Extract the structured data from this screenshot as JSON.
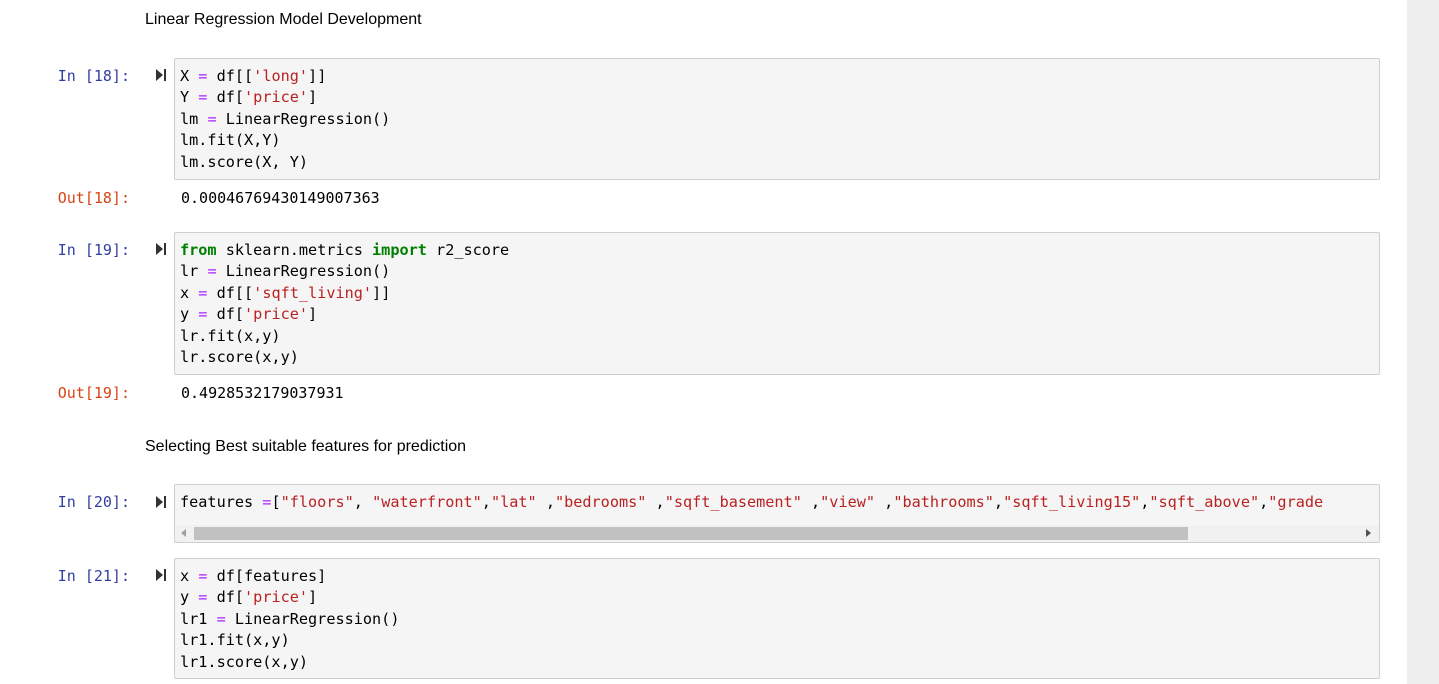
{
  "headings": {
    "model_dev": "Linear Regression Model Development",
    "feature_select": "Selecting Best suitable features for prediction"
  },
  "cells": {
    "c18": {
      "in_prompt": "In [18]:",
      "out_prompt": "Out[18]:",
      "output": "0.00046769430149007363"
    },
    "c19": {
      "in_prompt": "In [19]:",
      "out_prompt": "Out[19]:",
      "output": "0.4928532179037931"
    },
    "c20": {
      "in_prompt": "In [20]:"
    },
    "c21": {
      "in_prompt": "In [21]:"
    }
  },
  "code": {
    "c18": [
      [
        {
          "t": "X "
        },
        {
          "t": "=",
          "c": "op"
        },
        {
          "t": " df[["
        },
        {
          "t": "'long'",
          "c": "str"
        },
        {
          "t": "]]"
        }
      ],
      [
        {
          "t": "Y "
        },
        {
          "t": "=",
          "c": "op"
        },
        {
          "t": " df["
        },
        {
          "t": "'price'",
          "c": "str"
        },
        {
          "t": "]"
        }
      ],
      [
        {
          "t": "lm "
        },
        {
          "t": "=",
          "c": "op"
        },
        {
          "t": " LinearRegression()"
        }
      ],
      [
        {
          "t": "lm.fit(X,Y)"
        }
      ],
      [
        {
          "t": "lm.score(X, Y)"
        }
      ]
    ],
    "c19": [
      [
        {
          "t": "from",
          "c": "kw"
        },
        {
          "t": " sklearn.metrics "
        },
        {
          "t": "import",
          "c": "kw"
        },
        {
          "t": " r2_score"
        }
      ],
      [
        {
          "t": "lr "
        },
        {
          "t": "=",
          "c": "op"
        },
        {
          "t": " LinearRegression()"
        }
      ],
      [
        {
          "t": "x "
        },
        {
          "t": "=",
          "c": "op"
        },
        {
          "t": " df[["
        },
        {
          "t": "'sqft_living'",
          "c": "str"
        },
        {
          "t": "]]"
        }
      ],
      [
        {
          "t": "y "
        },
        {
          "t": "=",
          "c": "op"
        },
        {
          "t": " df["
        },
        {
          "t": "'price'",
          "c": "str"
        },
        {
          "t": "]"
        }
      ],
      [
        {
          "t": "lr.fit(x,y)"
        }
      ],
      [
        {
          "t": "lr.score(x,y)"
        }
      ]
    ],
    "c20": [
      [
        {
          "t": "features "
        },
        {
          "t": "=",
          "c": "op"
        },
        {
          "t": "["
        },
        {
          "t": "\"floors\"",
          "c": "str"
        },
        {
          "t": ", "
        },
        {
          "t": "\"waterfront\"",
          "c": "str"
        },
        {
          "t": ","
        },
        {
          "t": "\"lat\"",
          "c": "str"
        },
        {
          "t": " ,"
        },
        {
          "t": "\"bedrooms\"",
          "c": "str"
        },
        {
          "t": " ,"
        },
        {
          "t": "\"sqft_basement\"",
          "c": "str"
        },
        {
          "t": " ,"
        },
        {
          "t": "\"view\"",
          "c": "str"
        },
        {
          "t": " ,"
        },
        {
          "t": "\"bathrooms\"",
          "c": "str"
        },
        {
          "t": ","
        },
        {
          "t": "\"sqft_living15\"",
          "c": "str"
        },
        {
          "t": ","
        },
        {
          "t": "\"sqft_above\"",
          "c": "str"
        },
        {
          "t": ","
        },
        {
          "t": "\"grade",
          "c": "str"
        }
      ]
    ],
    "c21": [
      [
        {
          "t": "x "
        },
        {
          "t": "=",
          "c": "op"
        },
        {
          "t": " df[features]"
        }
      ],
      [
        {
          "t": "y "
        },
        {
          "t": "=",
          "c": "op"
        },
        {
          "t": " df["
        },
        {
          "t": "'price'",
          "c": "str"
        },
        {
          "t": "]"
        }
      ],
      [
        {
          "t": "lr1 "
        },
        {
          "t": "=",
          "c": "op"
        },
        {
          "t": " LinearRegression()"
        }
      ],
      [
        {
          "t": "lr1.fit(x,y)"
        }
      ],
      [
        {
          "t": "lr1.score(x,y)"
        }
      ]
    ]
  },
  "icons": {
    "run": "run-cell-icon",
    "scroll_left": "scroll-left-arrow-icon",
    "scroll_right": "scroll-right-arrow-icon"
  },
  "colors": {
    "in_prompt": "#303f9f",
    "out_prompt": "#d84315",
    "string": "#ba2121",
    "keyword": "#008000",
    "operator": "#aa22ff",
    "cell_bg": "#f5f5f5"
  }
}
